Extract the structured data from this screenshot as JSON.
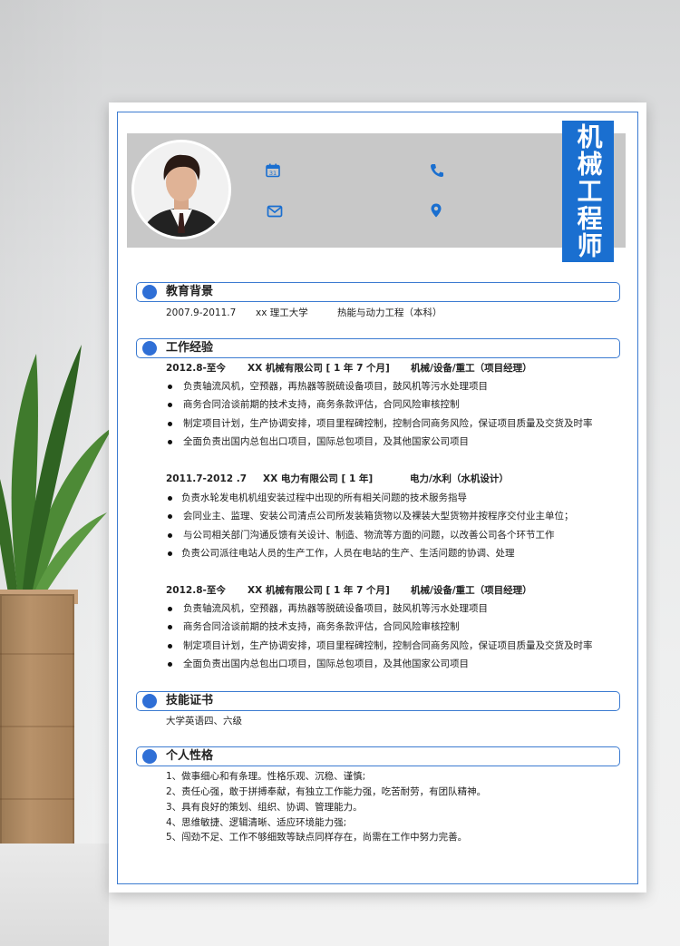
{
  "title": "机械工程师",
  "sections": {
    "education": {
      "heading": "教育背景",
      "period": "2007.9-2011.7",
      "school": "xx 理工大学",
      "major": "热能与动力工程（本科）"
    },
    "work": {
      "heading": "工作经验",
      "jobs": [
        {
          "period": "2012.8-至今",
          "company": "XX 机械有限公司 [ 1 年 7 个月]",
          "role": "机械/设备/重工（项目经理）",
          "bullets": [
            "负责轴流风机，空预器，再热器等脱硫设备项目，鼓风机等污水处理项目",
            "商务合同洽谈前期的技术支持，商务条款评估，合同风险审核控制",
            "制定项目计划，生产协调安排，项目里程碑控制，控制合同商务风险，保证项目质量及交货及时率",
            "全面负责出国内总包出口项目，国际总包项目，及其他国家公司项目"
          ]
        },
        {
          "period": "2011.7-2012 .7",
          "company": "XX 电力有限公司 [ 1 年]",
          "role": "电力/水利（水机设计）",
          "bullets": [
            " 负责水轮发电机机组安装过程中出现的所有相关问题的技术服务指导",
            "会同业主、监理、安装公司清点公司所发装箱货物以及裸装大型货物并按程序交付业主单位；",
            "与公司相关部门沟通反馈有关设计、制造、物流等方面的问题，以改善公司各个环节工作",
            " 负责公司派往电站人员的生产工作，人员在电站的生产、生活问题的协调、处理"
          ]
        },
        {
          "period": "2012.8-至今",
          "company": "XX 机械有限公司 [ 1 年 7 个月]",
          "role": "机械/设备/重工（项目经理）",
          "bullets": [
            "负责轴流风机，空预器，再热器等脱硫设备项目，鼓风机等污水处理项目",
            "商务合同洽谈前期的技术支持，商务条款评估，合同风险审核控制",
            "制定项目计划，生产协调安排，项目里程碑控制，控制合同商务风险，保证项目质量及交货及时率",
            "全面负责出国内总包出口项目，国际总包项目，及其他国家公司项目"
          ]
        }
      ]
    },
    "skills": {
      "heading": "技能证书",
      "text": "大学英语四、六级"
    },
    "personality": {
      "heading": "个人性格",
      "items": [
        "1、做事细心和有条理。性格乐观、沉稳、谨慎;",
        "2、责任心强，敢于拼搏奉献，有独立工作能力强，吃苦耐劳，有团队精神。",
        "3、具有良好的策划、组织、协调、管理能力。",
        "4、思维敏捷、逻辑清晰、适应环境能力强;",
        "5、闯劲不足、工作不够细致等缺点同样存在，尚需在工作中努力完善。"
      ]
    }
  },
  "icons": {
    "calendar": "calendar-icon",
    "phone": "phone-icon",
    "email": "email-icon",
    "location": "location-icon"
  },
  "colors": {
    "accent": "#1a6fd0",
    "border": "#3c7bd1",
    "header_band": "#c8c8c8"
  }
}
